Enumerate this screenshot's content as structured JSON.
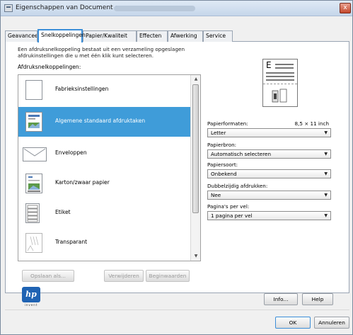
{
  "window": {
    "title": "Eigenschappen van Document op",
    "close_label": "x"
  },
  "tabs": [
    {
      "label": "Geavanceerd"
    },
    {
      "label": "Snelkoppelingen"
    },
    {
      "label": "Papier/Kwaliteit"
    },
    {
      "label": "Effecten"
    },
    {
      "label": "Afwerking"
    },
    {
      "label": "Service"
    }
  ],
  "shortcuts": {
    "description": "Een afdruksnelkoppeling bestaat uit een verzameling opgeslagen afdrukinstellingen die u met één klik kunt selecteren.",
    "list_label": "Afdruksnelkoppelingen:",
    "items": [
      {
        "label": "Fabrieksinstellingen",
        "icon": "blank-page-icon"
      },
      {
        "label": "Algemene standaard afdruktaken",
        "icon": "photo-page-icon",
        "selected": true
      },
      {
        "label": "Enveloppen",
        "icon": "envelope-icon"
      },
      {
        "label": "Karton/zwaar papier",
        "icon": "cardstock-icon"
      },
      {
        "label": "Etiket",
        "icon": "labels-icon"
      },
      {
        "label": "Transparant",
        "icon": "transparency-icon"
      }
    ],
    "buttons": {
      "save": "Opslaan als...",
      "delete": "Verwijderen",
      "reset": "Beginwaarden"
    }
  },
  "settings": {
    "paper_size_label": "Papierformaten:",
    "paper_size_dim": "8,5 × 11 inch",
    "paper_size_value": "Letter",
    "paper_source_label": "Papierbron:",
    "paper_source_value": "Automatisch selecteren",
    "paper_type_label": "Papiersoort:",
    "paper_type_value": "Onbekend",
    "duplex_label": "Dubbelzijdig afdrukken:",
    "duplex_value": "Nee",
    "pages_per_sheet_label": "Pagina's per vel:",
    "pages_per_sheet_value": "1 pagina per vel"
  },
  "footer": {
    "logo_text": "hp",
    "logo_tag": "invent",
    "info_button": "Info...",
    "help_button": "Help",
    "ok_button": "OK",
    "cancel_button": "Annuleren"
  }
}
